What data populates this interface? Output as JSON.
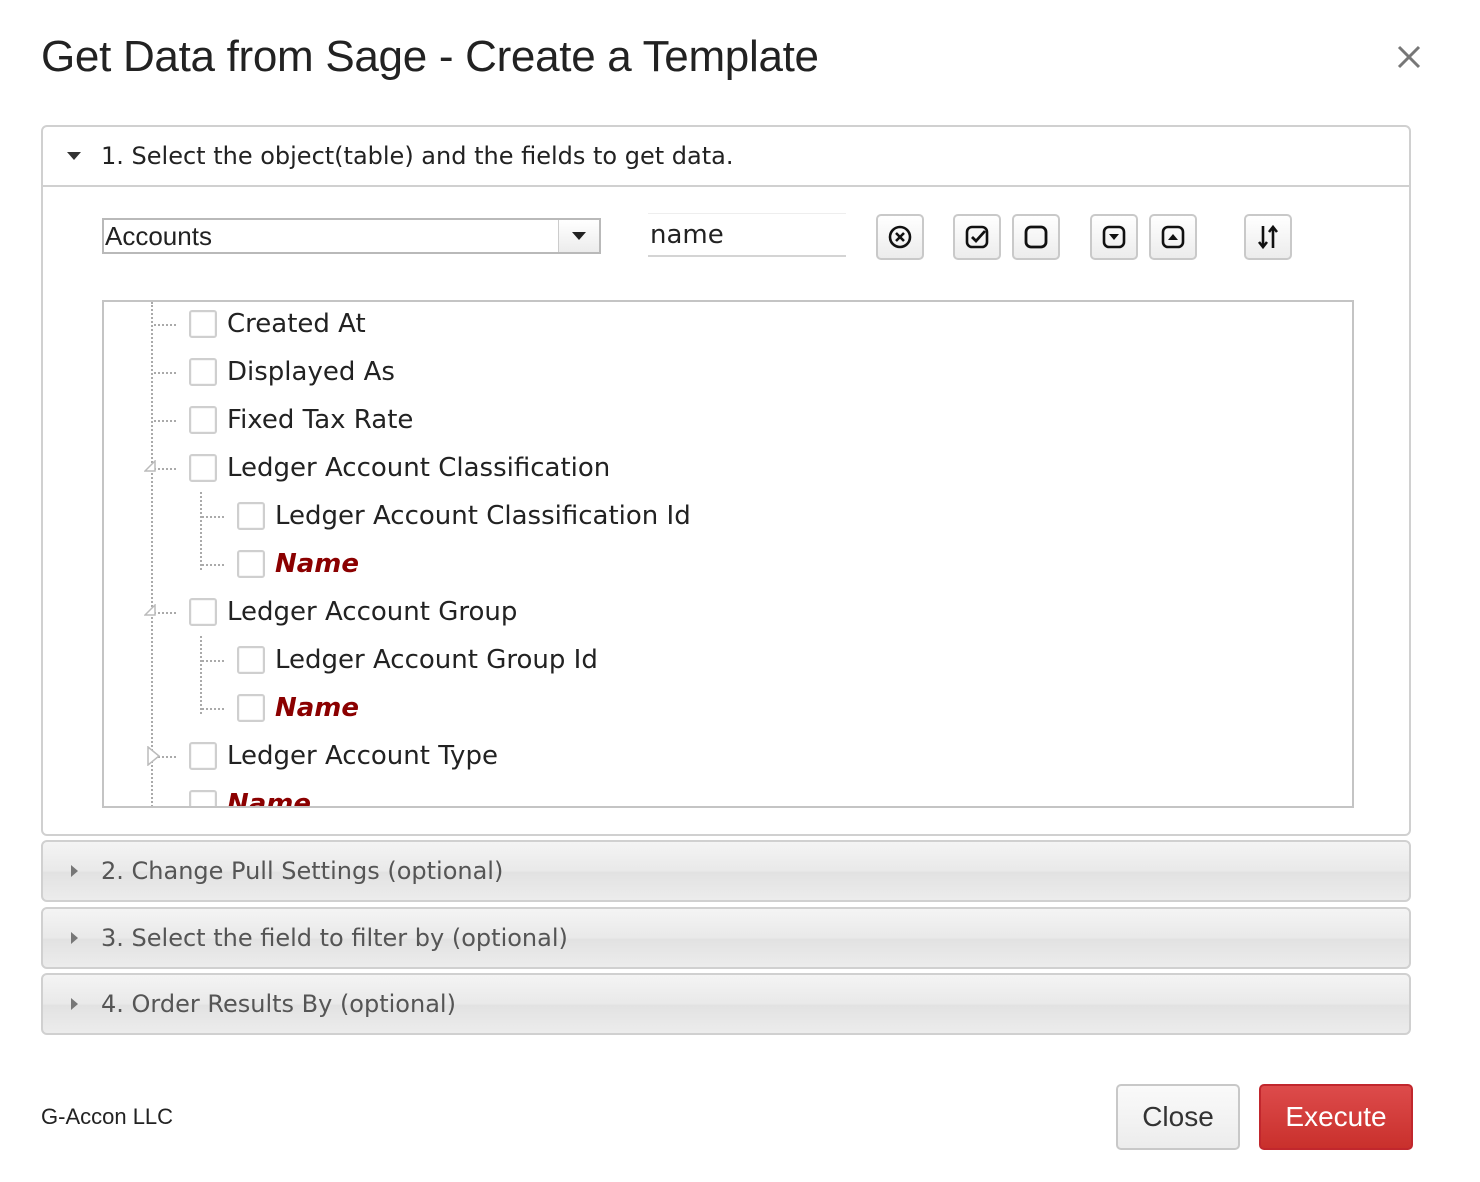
{
  "dialog": {
    "title": "Get Data from Sage - Create a Template",
    "close_icon": "close-icon"
  },
  "sections": [
    {
      "label": "1. Select the object(table) and the fields to get data.",
      "expanded": true
    },
    {
      "label": "2. Change Pull Settings (optional)",
      "expanded": false
    },
    {
      "label": "3. Select the field to filter by (optional)",
      "expanded": false
    },
    {
      "label": "4. Order Results By (optional)",
      "expanded": false
    }
  ],
  "toolbar": {
    "object_select_value": "Accounts",
    "search_value": "name",
    "buttons": [
      "clear-search-icon",
      "check-all-icon",
      "uncheck-all-icon",
      "expand-all-icon",
      "collapse-all-icon",
      "sort-icon"
    ]
  },
  "tree": {
    "items": [
      {
        "label": "Created At",
        "highlight": false,
        "level": 1
      },
      {
        "label": "Displayed As",
        "highlight": false,
        "level": 1
      },
      {
        "label": "Fixed Tax Rate",
        "highlight": false,
        "level": 1
      },
      {
        "label": "Ledger Account Classification",
        "highlight": false,
        "level": 1,
        "expanded": true
      },
      {
        "label": "Ledger Account Classification Id",
        "highlight": false,
        "level": 2
      },
      {
        "label": "Name",
        "highlight": true,
        "level": 2
      },
      {
        "label": "Ledger Account Group",
        "highlight": false,
        "level": 1,
        "expanded": true
      },
      {
        "label": "Ledger Account Group Id",
        "highlight": false,
        "level": 2
      },
      {
        "label": "Name",
        "highlight": true,
        "level": 2
      },
      {
        "label": "Ledger Account Type",
        "highlight": false,
        "level": 1,
        "expanded": false
      },
      {
        "label": "Name",
        "highlight": true,
        "level": 1
      }
    ]
  },
  "footer": {
    "brand": "G-Accon LLC",
    "close_label": "Close",
    "execute_label": "Execute"
  },
  "colors": {
    "highlight_text": "#8b0000",
    "execute_button": "#c9302c"
  }
}
